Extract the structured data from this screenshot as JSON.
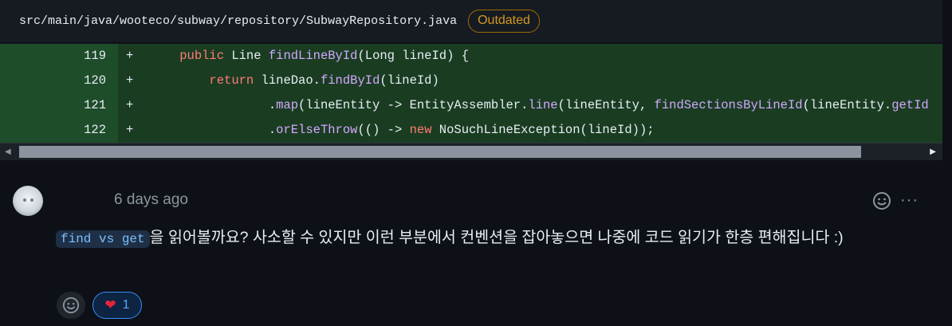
{
  "file": {
    "path": "src/main/java/wooteco/subway/repository/SubwayRepository.java",
    "status_badge": "Outdated"
  },
  "diff": {
    "lines": [
      {
        "number": "119",
        "marker": "+"
      },
      {
        "number": "120",
        "marker": "+"
      },
      {
        "number": "121",
        "marker": "+"
      },
      {
        "number": "122",
        "marker": "+"
      }
    ],
    "tokens": {
      "l119_public": "public",
      "l119_type": " Line ",
      "l119_fn": "findLineById",
      "l119_rest": "(Long lineId) {",
      "l120_return": "return",
      "l120_obj": " lineDao.",
      "l120_fn": "findById",
      "l120_rest": "(lineId)",
      "l121_dot": ".",
      "l121_map": "map",
      "l121_mid": "(lineEntity -> EntityAssembler.",
      "l121_line": "line",
      "l121_mid2": "(lineEntity, ",
      "l121_fn": "findSectionsByLineId",
      "l121_rest": "(lineEntity.",
      "l121_get": "getId",
      "l122_dot": ".",
      "l122_fn": "orElseThrow",
      "l122_mid": "(() -> ",
      "l122_new": "new",
      "l122_rest": " NoSuchLineException(lineId));"
    }
  },
  "scrollbar": {
    "left_arrow": "◀",
    "right_arrow": "▶"
  },
  "comment": {
    "time": "6 days ago",
    "more": "···",
    "inline_code": "find vs get",
    "body": "을 읽어볼까요? 사소할 수 있지만 이런 부분에서 컨벤션을 잡아놓으면 나중에 코드 읽기가 한층 편해집니다 :)",
    "reactions": [
      {
        "icon": "heart-icon",
        "glyph": "❤",
        "count": "1"
      }
    ]
  },
  "colors": {
    "badge": "#d29922",
    "diff_added_bg": "#1a3d22",
    "keyword": "#ff7b72",
    "function": "#d2a8ff",
    "reaction_border": "#388bfd"
  }
}
